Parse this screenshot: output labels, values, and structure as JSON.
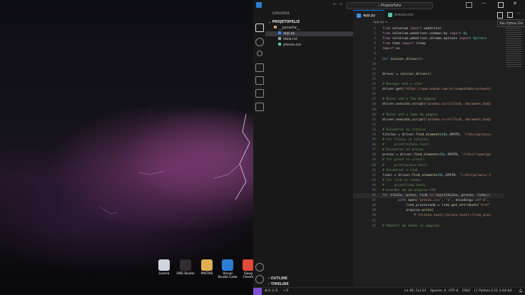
{
  "window": {
    "title": "ProjetoFeliz"
  },
  "sidebar": {
    "header": "EXPLORER",
    "folder": "PROJETOFELIZ",
    "items": [
      {
        "label": "__pycache__",
        "kind": "folder",
        "color": "#d19a66"
      },
      {
        "label": "app.py",
        "kind": "python",
        "color": "#3b8eea"
      },
      {
        "label": "ideia.txt",
        "kind": "text",
        "color": "#9aa0a6"
      },
      {
        "label": "precos.csv",
        "kind": "csv",
        "color": "#4ec9b0"
      }
    ],
    "outline": "OUTLINE",
    "timeline": "TIMELINE"
  },
  "tabs": [
    {
      "label": "app.py",
      "active": true,
      "color": "#3b8eea"
    },
    {
      "label": "precos.csv",
      "active": false,
      "color": "#4ec9b0"
    }
  ],
  "breadcrumb": "app.py > ...",
  "tooltip": "Run Python File",
  "code_lines": [
    {
      "n": "1",
      "t": "from selenium import webdriver"
    },
    {
      "n": "2",
      "t": "from selenium.webdriver.common.by import By"
    },
    {
      "n": "3",
      "t": "from selenium.webdriver.chrome.options import Options"
    },
    {
      "n": "4",
      "t": "from time import sleep"
    },
    {
      "n": "5",
      "t": "import os"
    },
    {
      "n": "6",
      "t": ""
    },
    {
      "n": "7",
      "t": "def iniciar_driver():"
    },
    {
      "n": "20",
      "t": ""
    },
    {
      "n": "21",
      "t": ""
    },
    {
      "n": "22",
      "t": "driver = iniciar_driver()"
    },
    {
      "n": "23",
      "t": ""
    },
    {
      "n": "24",
      "t": "# Navegar até o site"
    },
    {
      "n": "25",
      "t": "driver.get('https://www.kabum.com.br/computadores/monit"
    },
    {
      "n": "26",
      "t": ""
    },
    {
      "n": "27",
      "t": "# Rolar até o fim da página"
    },
    {
      "n": "28",
      "t": "driver.execute_script(\"window.scrollTo(0, document.body"
    },
    {
      "n": "29",
      "t": ""
    },
    {
      "n": "30",
      "t": "# Rolar até o topo da página"
    },
    {
      "n": "31",
      "t": "driver.execute_script(\"window.scrollTo(0, document.body"
    },
    {
      "n": "32",
      "t": ""
    },
    {
      "n": "33",
      "t": "# Encontrar os títulos"
    },
    {
      "n": "34",
      "t": "titulos = driver.find_elements(By.XPATH, \"//div[@class="
    },
    {
      "n": "35",
      "t": "# for titulo in titulos:"
    },
    {
      "n": "36",
      "t": "#     print(titulo.text)"
    },
    {
      "n": "37",
      "t": "# Encontrar os preços"
    },
    {
      "n": "38",
      "t": "precos = driver.find_elements(By.XPATH, \"//div//span[@c"
    },
    {
      "n": "39",
      "t": "# for preco in precos:"
    },
    {
      "n": "40",
      "t": "#     print(preco.text)"
    },
    {
      "n": "41",
      "t": "# Encontrar o link"
    },
    {
      "n": "42",
      "t": "links = driver.find_elements(By.XPATH, \"//div[@class='s"
    },
    {
      "n": "43",
      "t": "# for link in links:"
    },
    {
      "n": "44",
      "t": "#     print(link.text)"
    },
    {
      "n": "45",
      "t": "# Guardar em um arquivo CSV"
    },
    {
      "n": "46",
      "t": "for titulo, preco, link in zip(titulos, precos, links):"
    },
    {
      "n": "47",
      "t": "        with open('precos.csv', 'a', encoding='utf-8',"
    },
    {
      "n": "48",
      "t": "            link_processado = link.get_attribute('href'"
    },
    {
      "n": "49",
      "t": "            arquivo.write("
    },
    {
      "n": "50",
      "t": "                f'{titulo.text};{preco.text};{link_proc"
    },
    {
      "n": "51",
      "t": ""
    },
    {
      "n": "52",
      "t": "# Repetir em todas as páginas"
    }
  ],
  "statusbar": {
    "problems": "⊗ 0 ⚠ 0",
    "ports": "⑁ 0",
    "position": "Ln 46, Col 23",
    "spaces": "Spaces: 4",
    "encoding": "UTF-8",
    "eol": "CRLF",
    "language": "{} Python",
    "interpreter": "3.11.3 64-bit"
  },
  "desktop_icons": [
    {
      "label": "Lixeira",
      "color": "#cfd6dd"
    },
    {
      "label": "OBS Studio",
      "color": "#302e31"
    },
    {
      "label": "PASTAS",
      "color": "#e0b050"
    },
    {
      "label": "Visual Studio Code",
      "color": "#2a7fd4"
    },
    {
      "label": "Goog Chrom",
      "color": "#e04a3a"
    }
  ]
}
